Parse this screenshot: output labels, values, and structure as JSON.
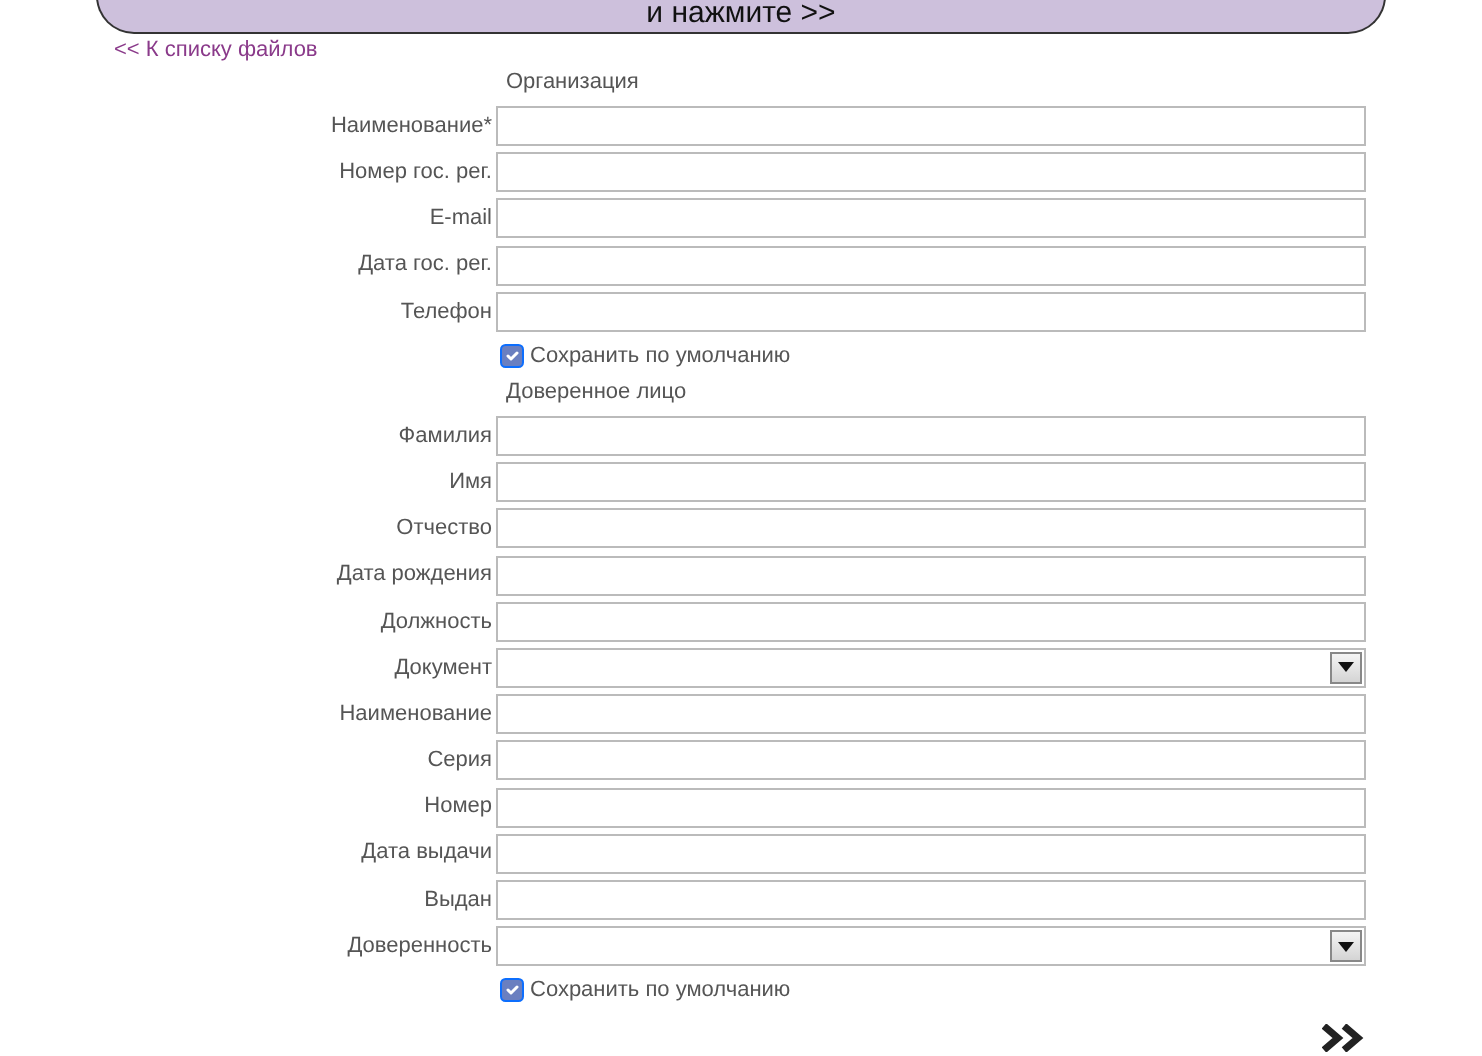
{
  "banner": {
    "text": "и нажмите >>"
  },
  "back_link": "<< К списку файлов",
  "sections": [
    {
      "title": "Организация",
      "fields": [
        {
          "label": "Наименование*",
          "kind": "text"
        },
        {
          "label": "Номер гос. рег.",
          "kind": "text"
        },
        {
          "label": "E-mail",
          "kind": "text"
        },
        {
          "label": "Дата гос. рег.",
          "kind": "text"
        },
        {
          "label": "Телефон",
          "kind": "text"
        }
      ],
      "save_default": {
        "label": "Сохранить по умолчанию",
        "checked": true
      }
    },
    {
      "title": "Доверенное лицо",
      "fields": [
        {
          "label": "Фамилия",
          "kind": "text"
        },
        {
          "label": "Имя",
          "kind": "text"
        },
        {
          "label": "Отчество",
          "kind": "text"
        },
        {
          "label": "Дата рождения",
          "kind": "text"
        },
        {
          "label": "Должность",
          "kind": "text"
        },
        {
          "label": "Документ",
          "kind": "select"
        },
        {
          "label": "Наименование",
          "kind": "text"
        },
        {
          "label": "Серия",
          "kind": "text"
        },
        {
          "label": "Номер",
          "kind": "text"
        },
        {
          "label": "Дата выдачи",
          "kind": "text"
        },
        {
          "label": "Выдан",
          "kind": "text"
        },
        {
          "label": "Доверенность",
          "kind": "select"
        }
      ],
      "save_default": {
        "label": "Сохранить по умолчанию",
        "checked": true
      }
    }
  ]
}
